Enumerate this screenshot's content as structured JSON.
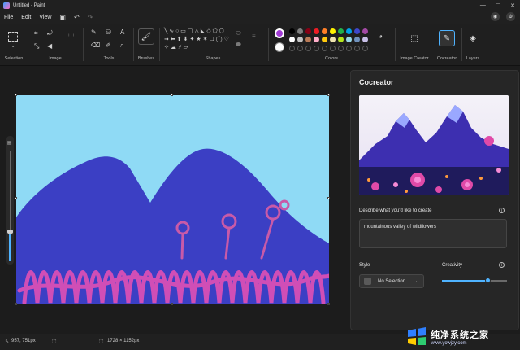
{
  "window": {
    "title": "Untitled - Paint"
  },
  "menu": {
    "file": "File",
    "edit": "Edit",
    "view": "View"
  },
  "ribbon": {
    "groups": {
      "selection": "Selection",
      "image": "Image",
      "tools": "Tools",
      "brushes": "Brushes",
      "shapes": "Shapes",
      "colors": "Colors",
      "image_creator": "Image Creator",
      "cocreator": "Cocreator",
      "layers": "Layers"
    },
    "colors": {
      "primary": "#a23bd6",
      "secondary": "#ffffff",
      "palette_row1": [
        "#000000",
        "#7f7f7f",
        "#880015",
        "#ed1c24",
        "#ff7f27",
        "#fff200",
        "#22b14c",
        "#00a2e8",
        "#3f48cc",
        "#a349a4"
      ],
      "palette_row2": [
        "#ffffff",
        "#c3c3c3",
        "#b97a57",
        "#ffaec9",
        "#ffc90e",
        "#efe4b0",
        "#b5e61d",
        "#99d9ea",
        "#7092be",
        "#c8bfe7"
      ]
    }
  },
  "cocreator": {
    "title": "Cocreator",
    "describe_label": "Describe what you'd like to create",
    "prompt": "mountainous valley of wildflowers",
    "style_label": "Style",
    "style_value": "No Selection",
    "creativity_label": "Creativity",
    "creativity_level": 0.7
  },
  "status": {
    "cursor_position": "957, 751px",
    "canvas_size": "1728 × 1152px"
  },
  "watermark": {
    "name": "纯净系统之家",
    "url": "www.ycwjzy.com"
  }
}
